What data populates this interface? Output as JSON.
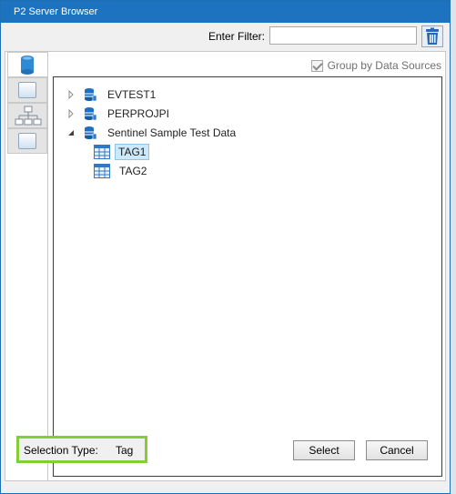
{
  "window": {
    "title": "P2 Server Browser"
  },
  "filter": {
    "label": "Enter Filter:",
    "value": "",
    "placeholder": ""
  },
  "side_tabs": [
    {
      "icon": "database-icon",
      "active": true
    },
    {
      "icon": "panel-icon",
      "active": false
    },
    {
      "icon": "hierarchy-icon",
      "active": false
    },
    {
      "icon": "panel-icon",
      "active": false
    }
  ],
  "group_by": {
    "label": "Group by Data Sources",
    "checked": true
  },
  "tree": {
    "nodes": [
      {
        "label": "EVTEST1",
        "type": "datasource",
        "expanded": false
      },
      {
        "label": "PERPROJPI",
        "type": "datasource",
        "expanded": false
      },
      {
        "label": "Sentinel Sample Test Data",
        "type": "datasource",
        "expanded": true
      },
      {
        "label": "TAG1",
        "type": "tag",
        "selected": true
      },
      {
        "label": "TAG2",
        "type": "tag",
        "selected": false
      }
    ]
  },
  "status": {
    "label": "Selection Type:",
    "value": "Tag"
  },
  "buttons": {
    "select": "Select",
    "cancel": "Cancel"
  },
  "colors": {
    "title_bar": "#1d73bf",
    "highlight_border": "#84cd33",
    "selection_bg": "#cde8f8"
  }
}
